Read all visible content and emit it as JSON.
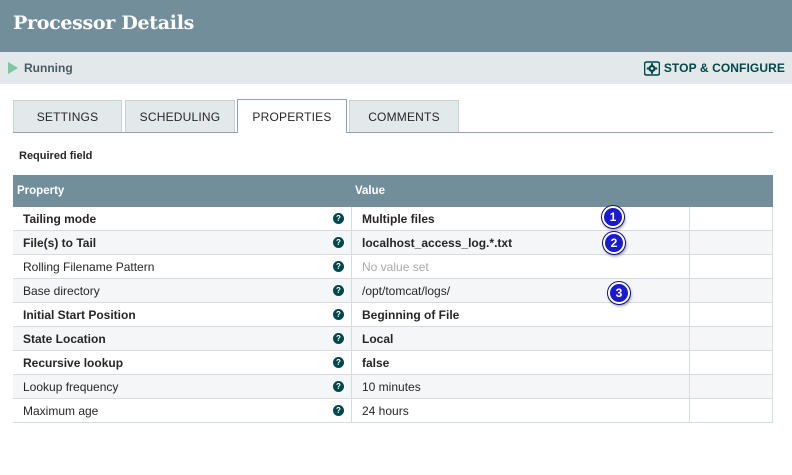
{
  "header": {
    "title": "Processor Details"
  },
  "status": {
    "label": "Running",
    "stop_configure_label": "STOP & CONFIGURE"
  },
  "tabs": [
    {
      "label": "SETTINGS",
      "active": false
    },
    {
      "label": "SCHEDULING",
      "active": false
    },
    {
      "label": "PROPERTIES",
      "active": true
    },
    {
      "label": "COMMENTS",
      "active": false
    }
  ],
  "required_label": "Required field",
  "grid": {
    "columns": {
      "property": "Property",
      "value": "Value"
    },
    "rows": [
      {
        "name": "Tailing mode",
        "required": true,
        "value": "Multiple files",
        "value_set": true
      },
      {
        "name": "File(s) to Tail",
        "required": true,
        "value": "localhost_access_log.*.txt",
        "value_set": true
      },
      {
        "name": "Rolling Filename Pattern",
        "required": false,
        "value": "No value set",
        "value_set": false
      },
      {
        "name": "Base directory",
        "required": false,
        "value": "/opt/tomcat/logs/",
        "value_set": true
      },
      {
        "name": "Initial Start Position",
        "required": true,
        "value": "Beginning of File",
        "value_set": true
      },
      {
        "name": "State Location",
        "required": true,
        "value": "Local",
        "value_set": true
      },
      {
        "name": "Recursive lookup",
        "required": true,
        "value": "false",
        "value_set": true
      },
      {
        "name": "Lookup frequency",
        "required": false,
        "value": "10 minutes",
        "value_set": true
      },
      {
        "name": "Maximum age",
        "required": false,
        "value": "24 hours",
        "value_set": true
      }
    ]
  },
  "markers": [
    "1",
    "2",
    "3"
  ],
  "icons": {
    "status": "play-icon",
    "stop_configure": "gear-stop-icon",
    "help": "help-icon"
  },
  "colors": {
    "header": "#728e9b",
    "running": "#7dc7a0",
    "accent": "#004849",
    "marker": "#1a1ad0"
  }
}
